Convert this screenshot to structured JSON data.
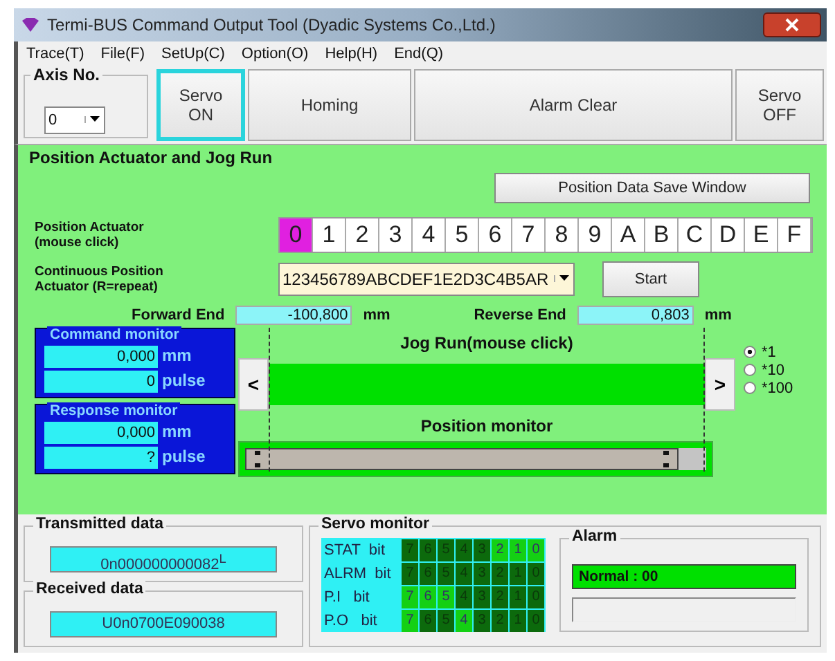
{
  "window": {
    "title": "Termi-BUS Command Output Tool (Dyadic Systems Co.,Ltd.)"
  },
  "menu": [
    "Trace(T)",
    "File(F)",
    "SetUp(C)",
    "Option(O)",
    "Help(H)",
    "End(Q)"
  ],
  "axis": {
    "label": "Axis No.",
    "value": "0"
  },
  "toolbar_buttons": [
    {
      "label": "Servo\nON",
      "focused": true,
      "kind": "narrow"
    },
    {
      "label": "Homing",
      "focused": false,
      "kind": "medium"
    },
    {
      "label": "Alarm Clear",
      "focused": false,
      "kind": "wide"
    },
    {
      "label": "Servo\nOFF",
      "focused": false,
      "kind": "narrow"
    }
  ],
  "panel": {
    "title": "Position Actuator and Jog Run",
    "save_button": "Position Data Save Window",
    "position_label": "Position Actuator\n(mouse click)",
    "positions": [
      {
        "label": "0",
        "selected": true
      },
      {
        "label": "1",
        "selected": false
      },
      {
        "label": "2",
        "selected": false
      },
      {
        "label": "3",
        "selected": false
      },
      {
        "label": "4",
        "selected": false
      },
      {
        "label": "5",
        "selected": false
      },
      {
        "label": "6",
        "selected": false
      },
      {
        "label": "7",
        "selected": false
      },
      {
        "label": "8",
        "selected": false
      },
      {
        "label": "9",
        "selected": false
      },
      {
        "label": "A",
        "selected": false
      },
      {
        "label": "B",
        "selected": false
      },
      {
        "label": "C",
        "selected": false
      },
      {
        "label": "D",
        "selected": false
      },
      {
        "label": "E",
        "selected": false
      },
      {
        "label": "F",
        "selected": false
      }
    ],
    "continuous_label": "Continuous Position\nActuator  (R=repeat)",
    "continuous_value": "123456789ABCDEF1E2D3C4B5AR",
    "start_button": "Start",
    "ends": [
      {
        "label": "Forward End",
        "value": "-100,800",
        "unit": "mm"
      },
      {
        "label": "Reverse End",
        "value": "0,803",
        "unit": "mm"
      }
    ],
    "monitors": [
      {
        "title": "Command monitor",
        "mm": "0,000",
        "mm_unit": "mm",
        "pulse": "0",
        "pulse_unit": "pulse"
      },
      {
        "title": "Response monitor",
        "mm": "0,000",
        "mm_unit": "mm",
        "pulse": "?",
        "pulse_unit": "pulse"
      }
    ],
    "jog_title": "Jog Run(mouse click)",
    "jog_left": "<",
    "jog_right": ">",
    "multipliers": [
      {
        "label": "*1",
        "selected": true
      },
      {
        "label": "*10",
        "selected": false
      },
      {
        "label": "*100",
        "selected": false
      }
    ],
    "position_monitor_title": "Position monitor"
  },
  "transmitted": {
    "title": "Transmitted data",
    "value": "0n000000000082$^{L}$"
  },
  "received": {
    "title": "Received data",
    "value": "U0n0700E090038"
  },
  "servo_monitor": {
    "title": "Servo monitor",
    "rows": [
      {
        "label": "STAT  bit",
        "bits": [
          {
            "label": "7",
            "on": false
          },
          {
            "label": "6",
            "on": false
          },
          {
            "label": "5",
            "on": false
          },
          {
            "label": "4",
            "on": false
          },
          {
            "label": "3",
            "on": false
          },
          {
            "label": "2",
            "on": true
          },
          {
            "label": "1",
            "on": true
          },
          {
            "label": "0",
            "on": true
          }
        ]
      },
      {
        "label": "ALRM  bit",
        "bits": [
          {
            "label": "7",
            "on": false
          },
          {
            "label": "6",
            "on": false
          },
          {
            "label": "5",
            "on": false
          },
          {
            "label": "4",
            "on": false
          },
          {
            "label": "3",
            "on": false
          },
          {
            "label": "2",
            "on": false
          },
          {
            "label": "1",
            "on": false
          },
          {
            "label": "0",
            "on": false
          }
        ]
      },
      {
        "label": "P.I   bit",
        "bits": [
          {
            "label": "7",
            "on": true
          },
          {
            "label": "6",
            "on": true
          },
          {
            "label": "5",
            "on": true
          },
          {
            "label": "4",
            "on": false
          },
          {
            "label": "3",
            "on": false
          },
          {
            "label": "2",
            "on": false
          },
          {
            "label": "1",
            "on": false
          },
          {
            "label": "0",
            "on": false
          }
        ]
      },
      {
        "label": "P.O   bit",
        "bits": [
          {
            "label": "7",
            "on": true
          },
          {
            "label": "6",
            "on": false
          },
          {
            "label": "5",
            "on": false
          },
          {
            "label": "4",
            "on": true
          },
          {
            "label": "3",
            "on": false
          },
          {
            "label": "2",
            "on": false
          },
          {
            "label": "1",
            "on": false
          },
          {
            "label": "0",
            "on": false
          }
        ]
      }
    ]
  },
  "alarm": {
    "title": "Alarm",
    "status": "Normal : 00"
  }
}
